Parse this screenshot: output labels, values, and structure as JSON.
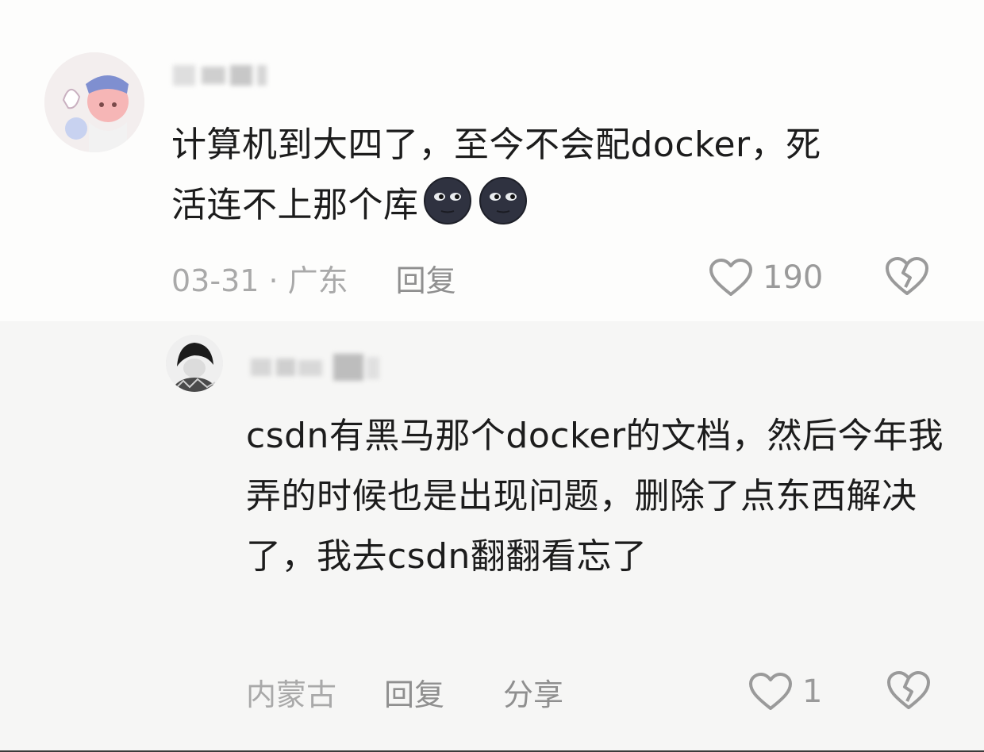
{
  "main_comment": {
    "text_line1": "计算机到大四了，至今不会配docker，死",
    "text_line2": "活连不上那个库",
    "emojis": [
      "new-moon-face-emoji",
      "new-moon-face-emoji"
    ],
    "date_location": "03-31 · 广东",
    "reply_label": "回复",
    "like_count": "190"
  },
  "reply_comment": {
    "text": "csdn有黑马那个docker的文档，然后今年我弄的时候也是出现问题，删除了点东西解决了，我去csdn翻翻看忘了",
    "location": "内蒙古",
    "reply_label": "回复",
    "share_label": "分享",
    "like_count": "1"
  },
  "icons": {
    "like": "heart-outline-icon",
    "dislike": "broken-heart-outline-icon"
  },
  "colors": {
    "text": "#1c1c1c",
    "meta": "#a9a9a9",
    "icon": "#9a9a9a",
    "reply_bg": "#f6f6f5"
  }
}
